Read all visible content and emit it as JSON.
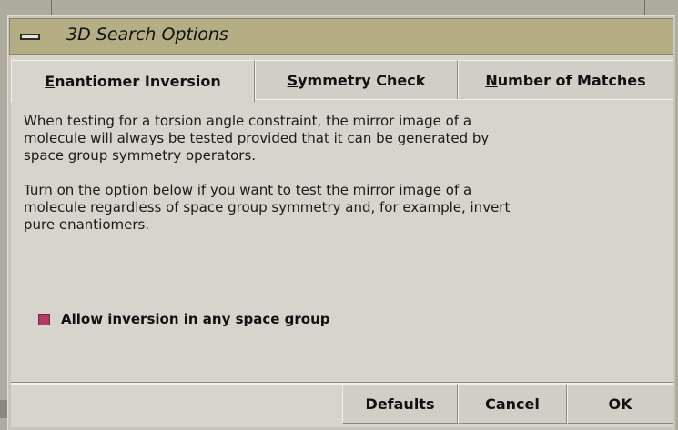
{
  "window": {
    "title": "3D Search Options"
  },
  "tabs": [
    {
      "mnemonic": "E",
      "rest": "nantiomer Inversion"
    },
    {
      "mnemonic": "S",
      "rest": "ymmetry Check"
    },
    {
      "mnemonic": "N",
      "rest": "umber of Matches"
    }
  ],
  "content": {
    "paragraph1": "When testing for a torsion angle constraint, the mirror image of a\nmolecule will always be tested provided that it can be generated by\nspace group symmetry operators.",
    "paragraph2": "Turn on the option below if you want to test the mirror image of a\nmolecule regardless of space group symmetry and, for example, invert\npure enantiomers.",
    "checkbox_label": "Allow inversion in any space group",
    "checkbox_checked": true
  },
  "buttons": {
    "defaults": "Defaults",
    "cancel": "Cancel",
    "ok": "OK"
  },
  "colors": {
    "titlebar": "#b5ad84",
    "checkbox_on": "#b83a64",
    "panel": "#d6d4cb"
  }
}
